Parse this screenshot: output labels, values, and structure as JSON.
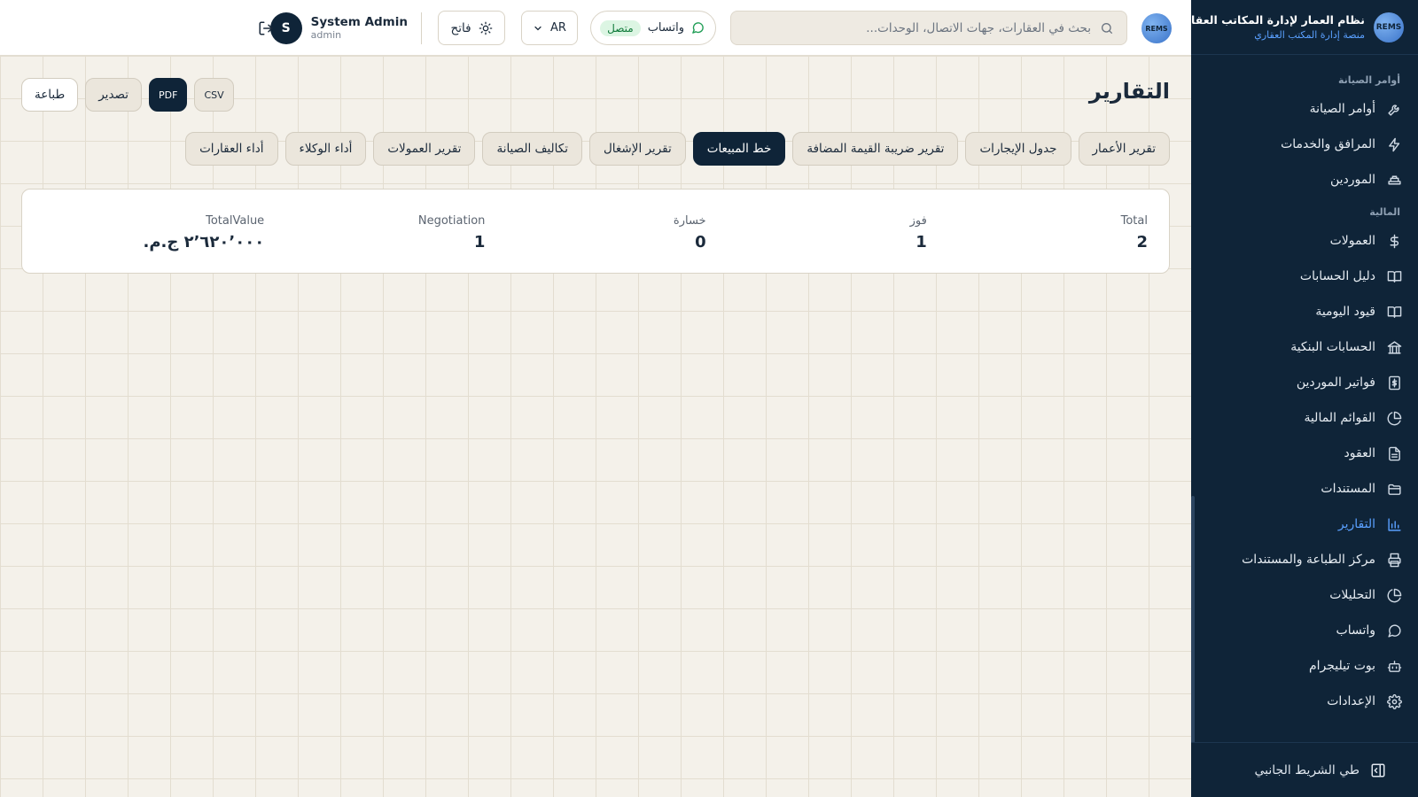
{
  "brand": {
    "logo_text": "REMS",
    "title": "نظام العمار لإدارة المكاتب العقارية",
    "subtitle": "منصة إدارة المكتب العقاري"
  },
  "sidebar": {
    "sections": [
      {
        "label": "أوامر الصيانة",
        "items": [
          {
            "label": "أوامر الصيانة",
            "icon": "wrench-icon"
          },
          {
            "label": "المرافق والخدمات",
            "icon": "bolt-icon"
          },
          {
            "label": "الموردين",
            "icon": "truck-icon"
          }
        ]
      },
      {
        "label": "المالية",
        "items": [
          {
            "label": "العمولات",
            "icon": "dollar-icon"
          },
          {
            "label": "دليل الحسابات",
            "icon": "book-icon"
          },
          {
            "label": "قيود اليومية",
            "icon": "book-open-icon"
          },
          {
            "label": "الحسابات البنكية",
            "icon": "bank-icon"
          },
          {
            "label": "فواتير الموردين",
            "icon": "invoice-icon"
          },
          {
            "label": "القوائم المالية",
            "icon": "pie-chart-icon"
          },
          {
            "label": "العقود",
            "icon": "file-text-icon"
          },
          {
            "label": "المستندات",
            "icon": "folder-icon"
          },
          {
            "label": "التقارير",
            "icon": "bar-chart-icon",
            "active": true
          },
          {
            "label": "مركز الطباعة والمستندات",
            "icon": "printer-icon"
          },
          {
            "label": "التحليلات",
            "icon": "pie-chart-icon"
          },
          {
            "label": "واتساب",
            "icon": "chat-icon"
          },
          {
            "label": "بوت تيليجرام",
            "icon": "bot-icon"
          },
          {
            "label": "الإعدادات",
            "icon": "gear-icon"
          }
        ]
      }
    ],
    "collapse_label": "طي الشريط الجانبي"
  },
  "topbar": {
    "avatar_text": "REMS",
    "search_placeholder": "بحث في العقارات، جهات الاتصال، الوحدات...",
    "whatsapp_label": "واتساب",
    "whatsapp_status": "متصل",
    "language": "AR",
    "theme_label": "فاتح",
    "user": {
      "initial": "S",
      "name": "System Admin",
      "role": "admin"
    }
  },
  "page": {
    "title": "التقارير",
    "actions": {
      "print": "طباعة",
      "export": "تصدير",
      "pdf": "PDF",
      "csv": "CSV"
    },
    "tabs": [
      {
        "label": "تقرير الأعمار"
      },
      {
        "label": "جدول الإيجارات"
      },
      {
        "label": "تقرير ضريبة القيمة المضافة"
      },
      {
        "label": "خط المبيعات",
        "active": true
      },
      {
        "label": "تقرير الإشغال"
      },
      {
        "label": "تكاليف الصيانة"
      },
      {
        "label": "تقرير العمولات"
      },
      {
        "label": "أداء الوكلاء"
      },
      {
        "label": "أداء العقارات"
      }
    ],
    "stats": [
      {
        "label": "Total",
        "value": "2"
      },
      {
        "label": "فوز",
        "value": "1"
      },
      {
        "label": "خسارة",
        "value": "0"
      },
      {
        "label": "Negotiation",
        "value": "1"
      },
      {
        "label": "TotalValue",
        "value": "٢٬٦٢٠٬٠٠٠ ج.م."
      }
    ]
  },
  "colors": {
    "sidebar_bg": "#0f2438",
    "accent": "#5aa0ff",
    "page_bg": "#f4f1ea",
    "active_tab": "#0f2438",
    "status_ok": "#0f7a3a"
  }
}
